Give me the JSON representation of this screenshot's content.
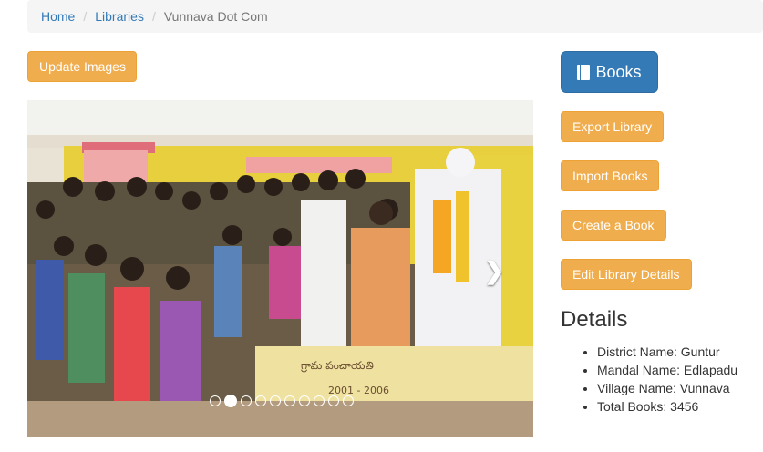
{
  "breadcrumb": {
    "items": [
      "Home",
      "Libraries"
    ],
    "current": "Vunnava Dot Com"
  },
  "actions": {
    "update_images": "Update Images"
  },
  "sidebar": {
    "books_button": "Books",
    "buttons": [
      "Export Library",
      "Import Books",
      "Create a Book",
      "Edit Library Details"
    ]
  },
  "carousel": {
    "slide_count": 10,
    "active_slide": 2,
    "next_icon": "chevron-right-icon",
    "photo_text": {
      "plaque": "గ్రామ పంచాయతి",
      "plaque_years": "2001 - 2006"
    }
  },
  "details": {
    "heading": "Details",
    "items": [
      "District Name: Guntur",
      "Mandal Name: Edlapadu",
      "Village Name: Vunnava",
      "Total Books: 3456"
    ]
  },
  "colors": {
    "primary": "#337ab7",
    "warning": "#f0ad4e",
    "breadcrumb_bg": "#f5f5f5"
  }
}
